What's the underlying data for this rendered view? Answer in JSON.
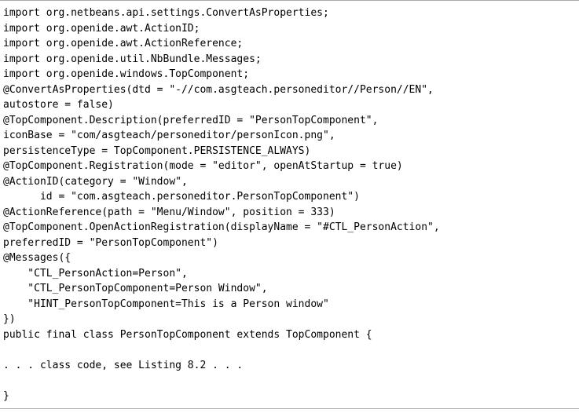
{
  "code": {
    "lines": [
      "import org.netbeans.api.settings.ConvertAsProperties;",
      "import org.openide.awt.ActionID;",
      "import org.openide.awt.ActionReference;",
      "import org.openide.util.NbBundle.Messages;",
      "import org.openide.windows.TopComponent;",
      "@ConvertAsProperties(dtd = \"-//com.asgteach.personeditor//Person//EN\",",
      "autostore = false)",
      "@TopComponent.Description(preferredID = \"PersonTopComponent\",",
      "iconBase = \"com/asgteach/personeditor/personIcon.png\",",
      "persistenceType = TopComponent.PERSISTENCE_ALWAYS)",
      "@TopComponent.Registration(mode = \"editor\", openAtStartup = true)",
      "@ActionID(category = \"Window\",",
      "      id = \"com.asgteach.personeditor.PersonTopComponent\")",
      "@ActionReference(path = \"Menu/Window\", position = 333)",
      "@TopComponent.OpenActionRegistration(displayName = \"#CTL_PersonAction\",",
      "preferredID = \"PersonTopComponent\")",
      "@Messages({",
      "    \"CTL_PersonAction=Person\",",
      "    \"CTL_PersonTopComponent=Person Window\",",
      "    \"HINT_PersonTopComponent=This is a Person window\"",
      "})",
      "public final class PersonTopComponent extends TopComponent {",
      "",
      ". . . class code, see Listing 8.2 . . .",
      "",
      "}"
    ]
  }
}
